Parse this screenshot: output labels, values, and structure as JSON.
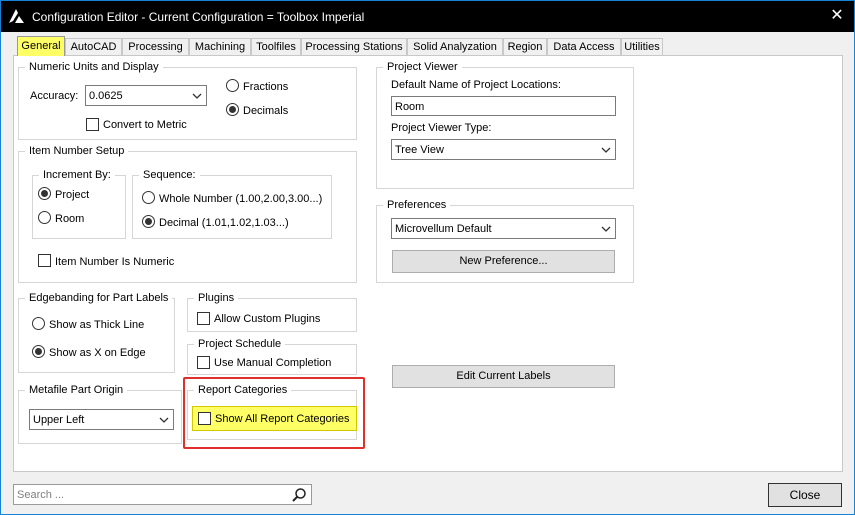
{
  "window": {
    "title": "Configuration Editor - Current Configuration = Toolbox Imperial",
    "close_symbol": "✕"
  },
  "tabs": [
    {
      "label": "General",
      "active": true
    },
    {
      "label": "AutoCAD"
    },
    {
      "label": "Processing"
    },
    {
      "label": "Machining"
    },
    {
      "label": "Toolfiles"
    },
    {
      "label": "Processing Stations"
    },
    {
      "label": "Solid Analyzation"
    },
    {
      "label": "Region"
    },
    {
      "label": "Data Access"
    },
    {
      "label": "Utilities"
    }
  ],
  "numeric_units": {
    "legend": "Numeric Units and Display",
    "accuracy_label": "Accuracy:",
    "accuracy_value": "0.0625",
    "convert_metric_label": "Convert to Metric",
    "convert_metric_checked": false,
    "fractions_label": "Fractions",
    "decimals_label": "Decimals",
    "selected": "Decimals"
  },
  "item_number": {
    "legend": "Item Number Setup",
    "increment_legend": "Increment By:",
    "project_label": "Project",
    "room_label": "Room",
    "increment_selected": "Project",
    "sequence_legend": "Sequence:",
    "whole_number_label": "Whole Number (1.00,2.00,3.00...)",
    "decimal_label": "Decimal (1.01,1.02,1.03...)",
    "sequence_selected": "Decimal",
    "numeric_label": "Item Number Is Numeric",
    "numeric_checked": false
  },
  "edgebanding": {
    "legend": "Edgebanding for Part Labels",
    "thick_line_label": "Show as Thick Line",
    "x_on_edge_label": "Show as X on Edge",
    "selected": "Show as X on Edge"
  },
  "plugins": {
    "legend": "Plugins",
    "allow_label": "Allow Custom Plugins",
    "allow_checked": false
  },
  "project_schedule": {
    "legend": "Project Schedule",
    "manual_label": "Use Manual Completion",
    "manual_checked": false
  },
  "metafile": {
    "legend": "Metafile Part Origin",
    "value": "Upper Left"
  },
  "report_categories": {
    "legend": "Report Categories",
    "show_all_label": "Show All Report Categories",
    "show_all_checked": false
  },
  "project_viewer": {
    "legend": "Project Viewer",
    "default_name_label": "Default Name of Project Locations:",
    "default_name_value": "Room",
    "type_label": "Project Viewer Type:",
    "type_value": "Tree View"
  },
  "preferences": {
    "legend": "Preferences",
    "value": "Microvellum Default",
    "new_button": "New Preference..."
  },
  "edit_labels_button": "Edit Current Labels",
  "search": {
    "placeholder": "Search ..."
  },
  "close_button": "Close",
  "colors": {
    "highlight_yellow": "#ffff66",
    "annotation_red": "#e0302c",
    "window_border": "#1783d6"
  }
}
